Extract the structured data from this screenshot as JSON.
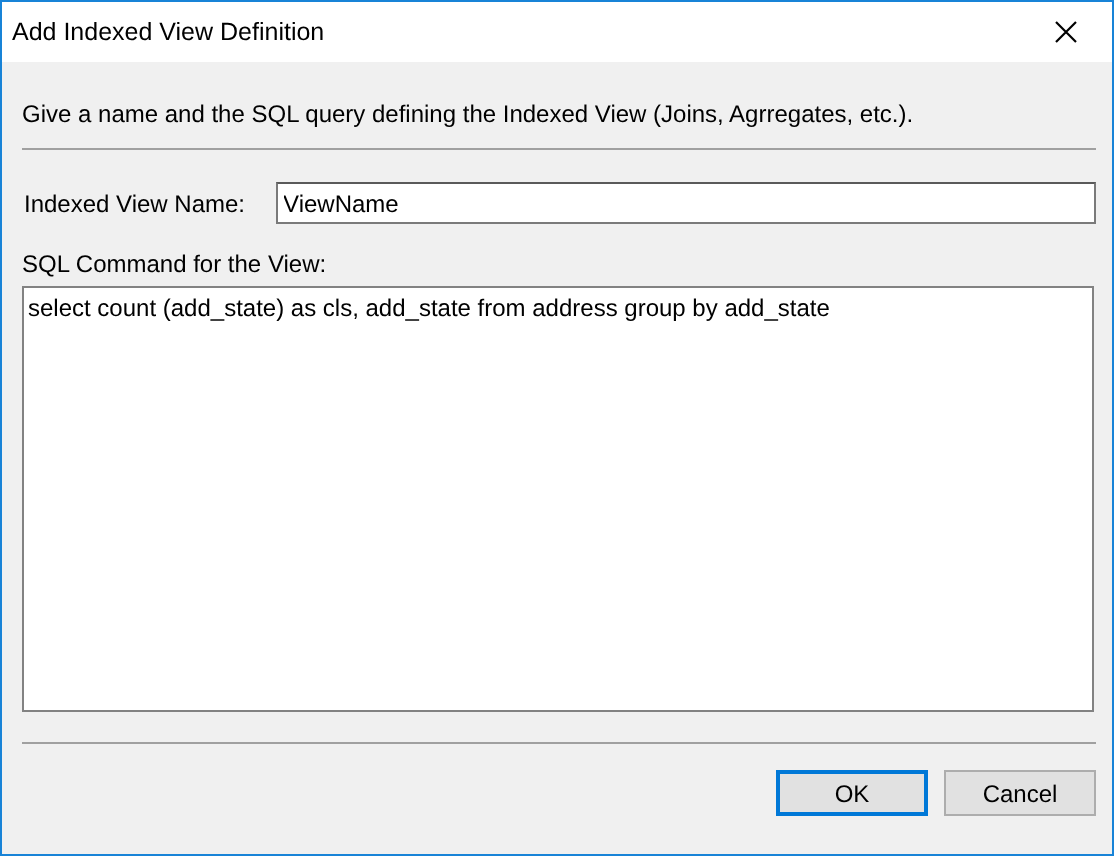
{
  "window": {
    "title": "Add Indexed View Definition"
  },
  "intro": "Give a name and the SQL query defining the Indexed View (Joins, Agrregates, etc.).",
  "name_field": {
    "label": "Indexed View Name:",
    "value": "ViewName"
  },
  "sql_field": {
    "label": "SQL Command for the View:",
    "value": "select count (add_state) as cls, add_state from address group by add_state"
  },
  "buttons": [
    {
      "label": "OK",
      "default": true
    },
    {
      "label": "Cancel",
      "default": false
    }
  ]
}
